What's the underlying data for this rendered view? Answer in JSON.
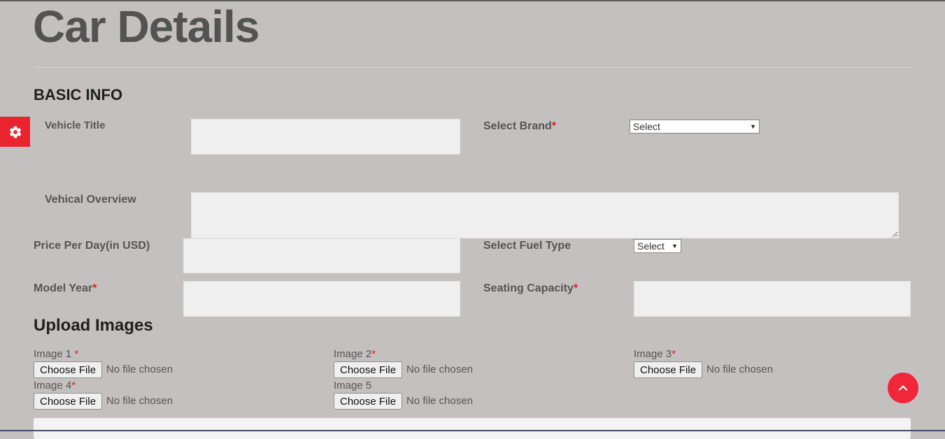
{
  "page_title": "Car Details",
  "basic_info": {
    "heading": "BASIC INFO",
    "vehicle_title": "Vehicle Title",
    "select_brand": "Select Brand",
    "brand_select_value": "Select",
    "vehicle_overview": "Vehical Overview",
    "price_per_day": "Price Per Day(in USD)",
    "select_fuel_type": "Select Fuel Type",
    "fuel_select_value": "Select",
    "model_year": "Model Year",
    "seating_capacity": "Seating Capacity",
    "required_mark": "*"
  },
  "upload_images": {
    "heading": "Upload Images",
    "images": [
      {
        "label": "Image 1 ",
        "required": "*",
        "button": "Choose File",
        "status": "No file chosen"
      },
      {
        "label": "Image 2",
        "required": "*",
        "button": "Choose File",
        "status": "No file chosen"
      },
      {
        "label": "Image 3",
        "required": "*",
        "button": "Choose File",
        "status": "No file chosen"
      },
      {
        "label": "Image 4",
        "required": "*",
        "button": "Choose File",
        "status": "No file chosen"
      },
      {
        "label": "Image 5",
        "required": "",
        "button": "Choose File",
        "status": "No file chosen"
      }
    ]
  },
  "icons": {
    "settings": "gear-icon",
    "scroll_top": "chevron-up-icon"
  },
  "colors": {
    "background": "#c4c0bf",
    "accent_red": "#e8242f",
    "required": "#e02020"
  }
}
